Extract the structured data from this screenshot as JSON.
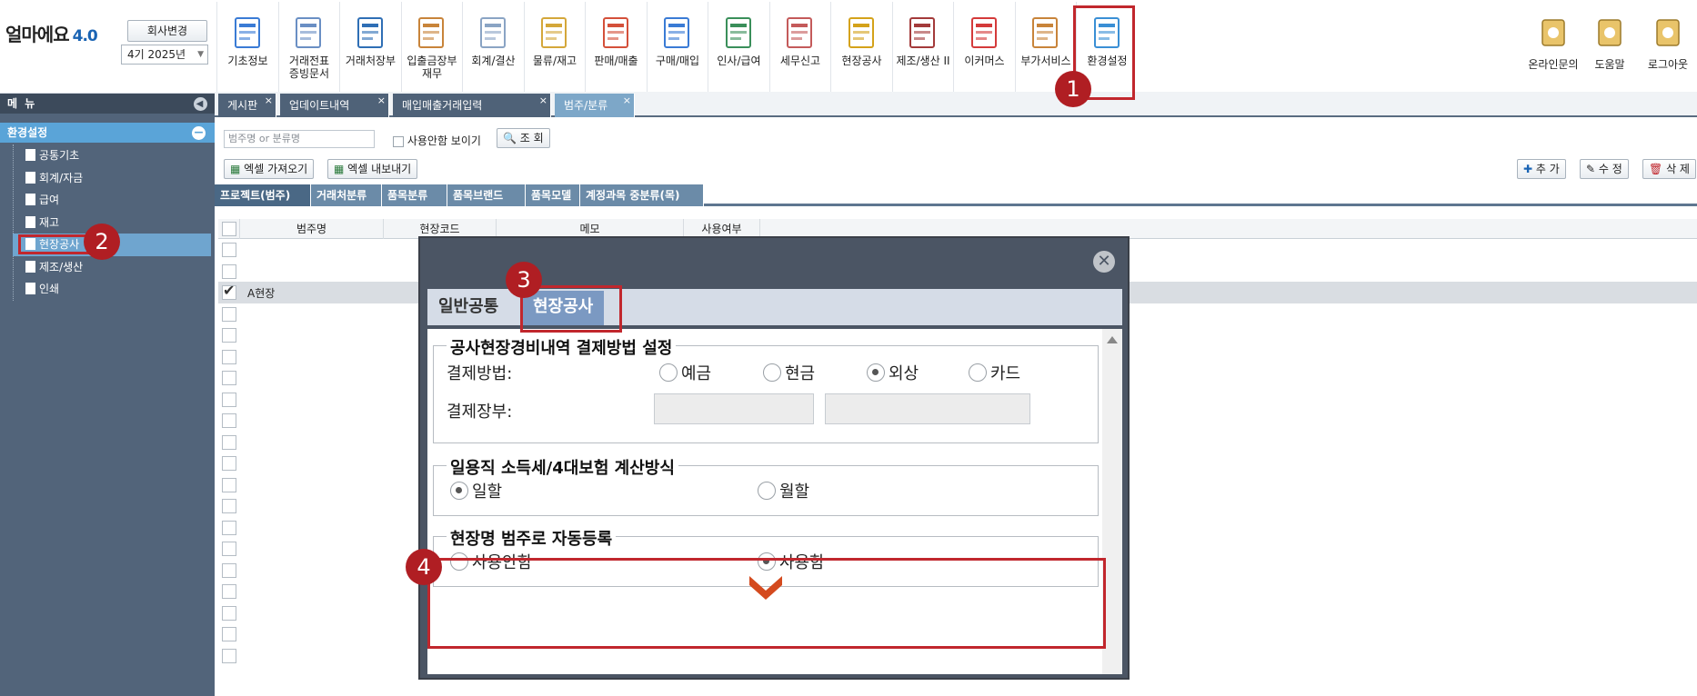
{
  "app": {
    "name": "얼마에요",
    "version": "4.0"
  },
  "header": {
    "company_button": "회사변경",
    "period": "4기 2025년",
    "menu": [
      {
        "label": "기초정보",
        "icon": "basic-info-icon"
      },
      {
        "label": "거래전표\n증빙문서",
        "icon": "voucher-icon"
      },
      {
        "label": "거래처장부",
        "icon": "ledger-icon"
      },
      {
        "label": "입출금장부\n재무",
        "icon": "cash-book-icon"
      },
      {
        "label": "회계/결산",
        "icon": "accounting-icon"
      },
      {
        "label": "물류/재고",
        "icon": "logistics-icon"
      },
      {
        "label": "판매/매출",
        "icon": "sales-icon"
      },
      {
        "label": "구매/매입",
        "icon": "purchase-icon"
      },
      {
        "label": "인사/급여",
        "icon": "hr-icon"
      },
      {
        "label": "세무신고",
        "icon": "tax-icon"
      },
      {
        "label": "현장공사",
        "icon": "construction-icon"
      },
      {
        "label": "제조/생산 II",
        "icon": "factory-icon"
      },
      {
        "label": "이커머스",
        "icon": "ecommerce-icon"
      },
      {
        "label": "부가서비스",
        "icon": "bank-icon"
      },
      {
        "label": "환경설정",
        "icon": "settings-gear-icon"
      }
    ],
    "right": [
      {
        "label": "온라인문의",
        "icon": "online-support-icon"
      },
      {
        "label": "도움말",
        "icon": "help-book-icon"
      },
      {
        "label": "로그아웃",
        "icon": "logout-icon"
      }
    ]
  },
  "sidebar": {
    "title": "메 뉴",
    "section": "환경설정",
    "items": [
      "공통기초",
      "회계/자금",
      "급여",
      "재고",
      "현장공사",
      "제조/생산",
      "인쇄"
    ],
    "selected": "현장공사"
  },
  "tabs": [
    {
      "label": "게시판"
    },
    {
      "label": "업데이트내역"
    },
    {
      "label": "매입매출거래입력"
    },
    {
      "label": "범주/분류",
      "active": true
    }
  ],
  "toolbar": {
    "search_placeholder": "범주명 or 분류명",
    "show_unused_label": "사용안함 보이기",
    "search_button": "조 회",
    "excel_import": "엑셀 가져오기",
    "excel_export": "엑셀 내보내기",
    "add_button": "추 가",
    "edit_button": "수 정",
    "delete_button": "삭 제"
  },
  "subtabs": [
    "프로젝트(범주)",
    "거래처분류",
    "품목분류",
    "품목브랜드",
    "품목모델",
    "계정과목 중분류(목)"
  ],
  "grid": {
    "columns": [
      "범주명",
      "현장코드",
      "메모",
      "사용여부"
    ],
    "rows": [
      {
        "name": "",
        "checked": false
      },
      {
        "name": "",
        "checked": false
      },
      {
        "name": "A현장",
        "checked": true
      }
    ]
  },
  "dialog": {
    "tabs": [
      "일반공통",
      "현장공사"
    ],
    "active_tab": "현장공사",
    "payment": {
      "legend": "공사현장경비내역 결제방법 설정",
      "method_label": "결제방법:",
      "options": [
        "예금",
        "현금",
        "외상",
        "카드"
      ],
      "selected": "외상",
      "book_label": "결제장부:"
    },
    "tax": {
      "legend": "일용직 소득세/4대보험 계산방식",
      "options": [
        "일할",
        "월할"
      ],
      "selected": "일할"
    },
    "auto_register": {
      "legend": "현장명 범주로 자동등록",
      "options": [
        "사용안함",
        "사용함"
      ],
      "selected": "사용함"
    }
  },
  "annotations": [
    "1",
    "2",
    "3",
    "4"
  ],
  "colors": {
    "highlight": "#c1272d",
    "sidebar": "#52647a",
    "accent": "#5aa4d8"
  }
}
